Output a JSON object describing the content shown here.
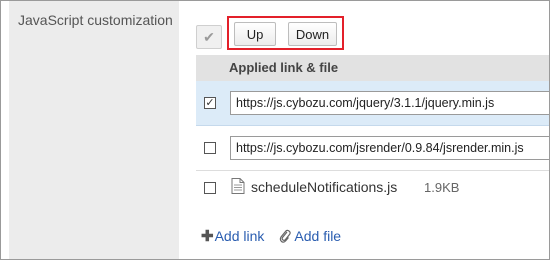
{
  "section": {
    "label": "JavaScript customization"
  },
  "toolbar": {
    "up_label": "Up",
    "down_label": "Down"
  },
  "table": {
    "header": "Applied link & file",
    "rows": [
      {
        "type": "link",
        "checked": true,
        "value": "https://js.cybozu.com/jquery/3.1.1/jquery.min.js"
      },
      {
        "type": "link",
        "checked": false,
        "value": "https://js.cybozu.com/jsrender/0.9.84/jsrender.min.js"
      },
      {
        "type": "file",
        "checked": false,
        "name": "scheduleNotifications.js",
        "size": "1.9KB"
      }
    ]
  },
  "actions": {
    "add_link": "Add link",
    "add_file": "Add file"
  },
  "colors": {
    "highlight_border": "#e3202a",
    "selected_row": "#dcebf8",
    "link": "#2a5db0"
  },
  "icons": {
    "check_all": "checkmark-icon",
    "file": "file-icon",
    "add": "plus-icon",
    "attach": "paperclip-icon"
  }
}
